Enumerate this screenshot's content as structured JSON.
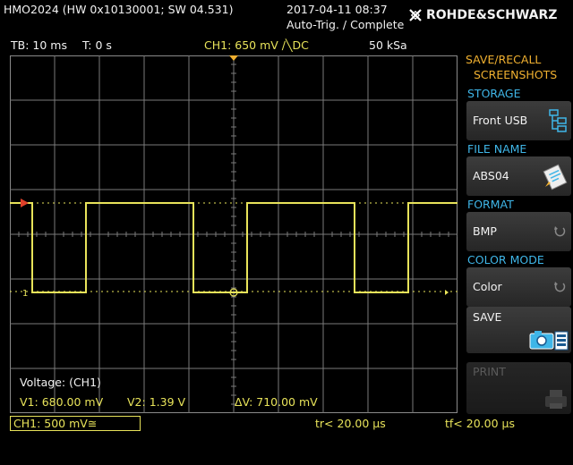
{
  "header": {
    "title": "HMO2024 (HW 0x10130001; SW 04.531)",
    "datetime": "2017-04-11 08:37",
    "trigger_status": "Auto-Trig. / Complete",
    "brand": "ROHDE&SCHWARZ"
  },
  "status_line": {
    "timebase": "TB: 10 ms",
    "time_offset": "T: 0 s",
    "channel_setting": "CH1: 650 mV ∕╲DC",
    "sample_rate": "50 kSa"
  },
  "waveform": {
    "channel_marker": "1",
    "trigger_marker": "T",
    "ground_marker": "1",
    "high_level_divisions": 0.7,
    "low_level_divisions": -1.3,
    "edges_divisions": [
      0.5,
      1.7,
      4.1,
      5.3,
      7.7,
      8.9
    ],
    "start_level": "high"
  },
  "measurement": {
    "title": "Voltage: (CH1)",
    "v1": "V1: 680.00 mV",
    "v2": "V2: 1.39 V",
    "dv": "ΔV: 710.00 mV"
  },
  "bottom_bar": {
    "ch1_scale": "CH1: 500 mV≅",
    "rise_time": "tr< 20.00 µs",
    "fall_time": "tf< 20.00 µs"
  },
  "menu": {
    "title_line1": "SAVE/RECALL",
    "title_line2": "SCREENSHOTS",
    "storage_label": "STORAGE",
    "storage_value": "Front USB",
    "file_name_label": "FILE NAME",
    "file_name_value": "ABS04",
    "format_label": "FORMAT",
    "format_value": "BMP",
    "color_mode_label": "COLOR MODE",
    "color_mode_value": "Color",
    "save_label": "SAVE",
    "print_label": "PRINT"
  },
  "colors": {
    "trace": "#e8e35a",
    "menu_label": "#3fb6e8",
    "accent": "#f0b030",
    "grid": "#7a7a7a"
  }
}
